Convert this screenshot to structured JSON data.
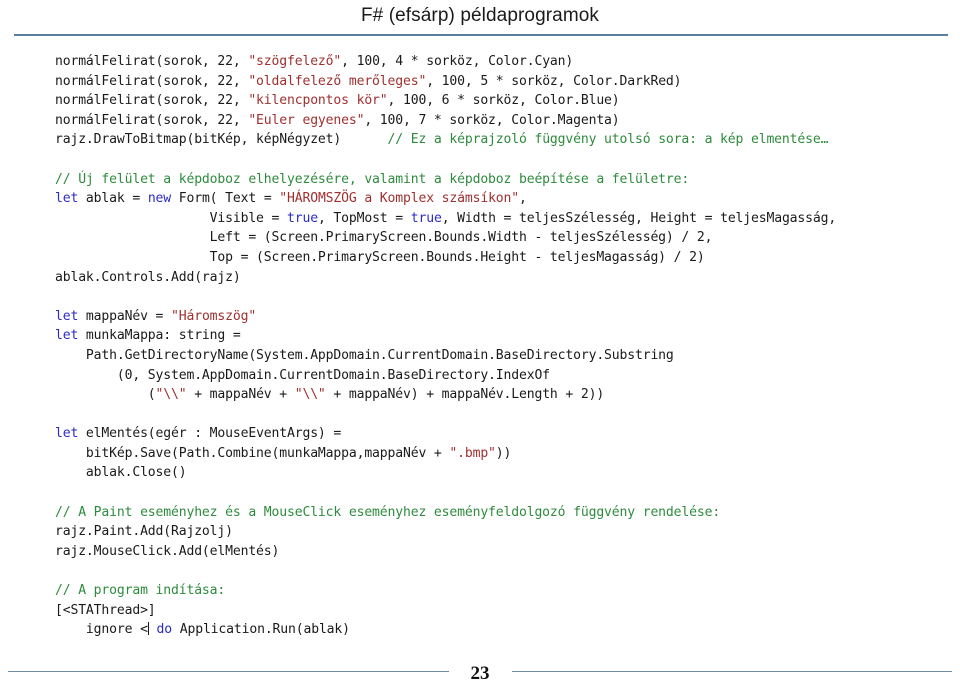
{
  "header": {
    "title": "F# (efsárp) példaprogramok"
  },
  "footer": {
    "page_number": "23"
  },
  "colors": {
    "rule": "#5b7fa0",
    "comment": "#2e8b3d",
    "string": "#a03030",
    "keyword": "#2b2bc8",
    "text": "#1a1a1a",
    "background": "#ffffff"
  },
  "code": {
    "language": "F#",
    "lines": [
      {
        "id": "line-1",
        "tokens": [
          {
            "t": "plain",
            "v": "normálFelirat(sorok, 22, "
          },
          {
            "t": "string",
            "v": "\"szögfelező\""
          },
          {
            "t": "plain",
            "v": ", 100, 4 * sorköz, Color.Cyan)"
          }
        ]
      },
      {
        "id": "line-2",
        "tokens": [
          {
            "t": "plain",
            "v": "normálFelirat(sorok, 22, "
          },
          {
            "t": "string",
            "v": "\"oldalfelező merőleges\""
          },
          {
            "t": "plain",
            "v": ", 100, 5 * sorköz, Color.DarkRed)"
          }
        ]
      },
      {
        "id": "line-3",
        "tokens": [
          {
            "t": "plain",
            "v": "normálFelirat(sorok, 22, "
          },
          {
            "t": "string",
            "v": "\"kilencpontos kör\""
          },
          {
            "t": "plain",
            "v": ", 100, 6 * sorköz, Color.Blue)"
          }
        ]
      },
      {
        "id": "line-4",
        "tokens": [
          {
            "t": "plain",
            "v": "normálFelirat(sorok, 22, "
          },
          {
            "t": "string",
            "v": "\"Euler egyenes\""
          },
          {
            "t": "plain",
            "v": ", 100, 7 * sorköz, Color.Magenta)"
          }
        ]
      },
      {
        "id": "line-5",
        "tokens": [
          {
            "t": "plain",
            "v": "rajz.DrawToBitmap(bitKép, képNégyzet)      "
          },
          {
            "t": "comment",
            "v": "// Ez a képrajzoló függvény utolsó sora: a kép elmentése…"
          }
        ]
      },
      {
        "id": "line-6",
        "tokens": []
      },
      {
        "id": "line-7",
        "tokens": [
          {
            "t": "comment",
            "v": "// Új felület a képdoboz elhelyezésére, valamint a képdoboz beépítése a felületre:"
          }
        ]
      },
      {
        "id": "line-8",
        "tokens": [
          {
            "t": "kw",
            "v": "let"
          },
          {
            "t": "plain",
            "v": " ablak = "
          },
          {
            "t": "kw",
            "v": "new"
          },
          {
            "t": "plain",
            "v": " Form( Text = "
          },
          {
            "t": "string",
            "v": "\"HÁROMSZÖG a Komplex számsíkon\""
          },
          {
            "t": "plain",
            "v": ","
          }
        ]
      },
      {
        "id": "line-9",
        "tokens": [
          {
            "t": "plain",
            "v": "                    Visible = "
          },
          {
            "t": "kw",
            "v": "true"
          },
          {
            "t": "plain",
            "v": ", TopMost = "
          },
          {
            "t": "kw",
            "v": "true"
          },
          {
            "t": "plain",
            "v": ", Width = teljesSzélesség, Height = teljesMagasság,"
          }
        ]
      },
      {
        "id": "line-10",
        "tokens": [
          {
            "t": "plain",
            "v": "                    Left = (Screen.PrimaryScreen.Bounds.Width - teljesSzélesség) / 2,"
          }
        ]
      },
      {
        "id": "line-11",
        "tokens": [
          {
            "t": "plain",
            "v": "                    Top = (Screen.PrimaryScreen.Bounds.Height - teljesMagasság) / 2)"
          }
        ]
      },
      {
        "id": "line-12",
        "tokens": [
          {
            "t": "plain",
            "v": "ablak.Controls.Add(rajz)"
          }
        ]
      },
      {
        "id": "line-13",
        "tokens": []
      },
      {
        "id": "line-14",
        "tokens": [
          {
            "t": "kw",
            "v": "let"
          },
          {
            "t": "plain",
            "v": " mappaNév = "
          },
          {
            "t": "string",
            "v": "\"Háromszög\""
          }
        ]
      },
      {
        "id": "line-15",
        "tokens": [
          {
            "t": "kw",
            "v": "let"
          },
          {
            "t": "plain",
            "v": " munkaMappa: string ="
          }
        ]
      },
      {
        "id": "line-16",
        "tokens": [
          {
            "t": "plain",
            "v": "    Path.GetDirectoryName(System.AppDomain.CurrentDomain.BaseDirectory.Substring"
          }
        ]
      },
      {
        "id": "line-17",
        "tokens": [
          {
            "t": "plain",
            "v": "        (0, System.AppDomain.CurrentDomain.BaseDirectory.IndexOf"
          }
        ]
      },
      {
        "id": "line-18",
        "tokens": [
          {
            "t": "plain",
            "v": "            ("
          },
          {
            "t": "string",
            "v": "\"\\\\\""
          },
          {
            "t": "plain",
            "v": " + mappaNév + "
          },
          {
            "t": "string",
            "v": "\"\\\\\""
          },
          {
            "t": "plain",
            "v": " + mappaNév) + mappaNév.Length + 2))"
          }
        ]
      },
      {
        "id": "line-19",
        "tokens": []
      },
      {
        "id": "line-20",
        "tokens": [
          {
            "t": "kw",
            "v": "let"
          },
          {
            "t": "plain",
            "v": " elMentés(egér : MouseEventArgs) ="
          }
        ]
      },
      {
        "id": "line-21",
        "tokens": [
          {
            "t": "plain",
            "v": "    bitKép.Save(Path.Combine(munkaMappa,mappaNév + "
          },
          {
            "t": "string",
            "v": "\".bmp\""
          },
          {
            "t": "plain",
            "v": "))"
          }
        ]
      },
      {
        "id": "line-22",
        "tokens": [
          {
            "t": "plain",
            "v": "    ablak.Close()"
          }
        ]
      },
      {
        "id": "line-23",
        "tokens": []
      },
      {
        "id": "line-24",
        "tokens": [
          {
            "t": "comment",
            "v": "// A Paint eseményhez és a MouseClick eseményhez eseményfeldolgozó függvény rendelése:"
          }
        ]
      },
      {
        "id": "line-25",
        "tokens": [
          {
            "t": "plain",
            "v": "rajz.Paint.Add(Rajzolj)"
          }
        ]
      },
      {
        "id": "line-26",
        "tokens": [
          {
            "t": "plain",
            "v": "rajz.MouseClick.Add(elMentés)"
          }
        ]
      },
      {
        "id": "line-27",
        "tokens": []
      },
      {
        "id": "line-28",
        "tokens": [
          {
            "t": "comment",
            "v": "// A program indítása:"
          }
        ]
      },
      {
        "id": "line-29",
        "tokens": [
          {
            "t": "plain",
            "v": "[<STAThread>]"
          }
        ]
      },
      {
        "id": "line-30",
        "tokens": [
          {
            "t": "plain",
            "v": "    ignore <"
          },
          {
            "t": "caret",
            "v": "|"
          },
          {
            "t": "plain",
            "v": " "
          },
          {
            "t": "kw",
            "v": "do"
          },
          {
            "t": "plain",
            "v": " Application.Run(ablak)"
          }
        ]
      }
    ]
  }
}
